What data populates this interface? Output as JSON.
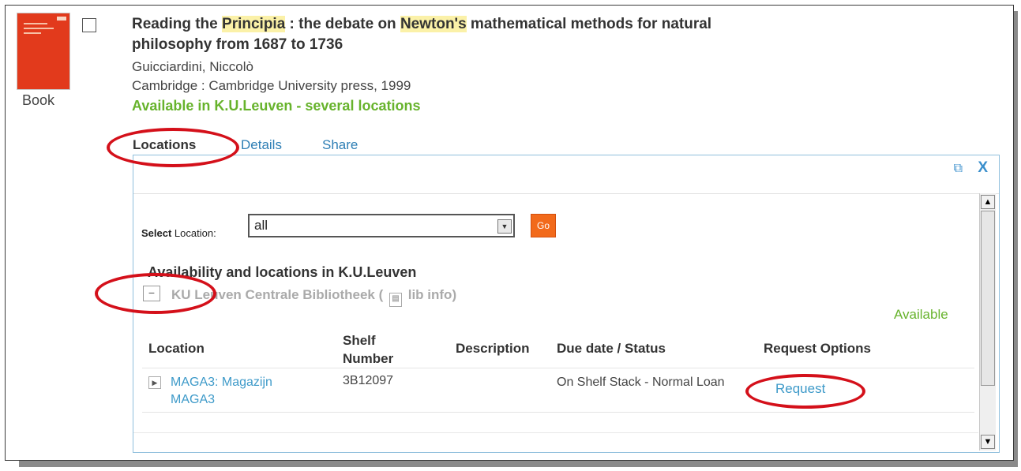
{
  "record": {
    "format": "Book",
    "title_part1": "Reading the ",
    "title_hl1": "Principia",
    "title_part2": " : the debate on ",
    "title_hl2": "Newton's",
    "title_part3": " mathematical methods for natural philosophy from 1687 to 1736",
    "author": "Guicciardini, Niccolò",
    "publisher": "Cambridge : Cambridge University press, 1999",
    "availability": "Available in K.U.Leuven - several locations"
  },
  "tabs": {
    "locations": "Locations",
    "details": "Details",
    "share": "Share"
  },
  "panel": {
    "close_label": "X",
    "select_location_bold": "Select",
    "select_location_label": " Location:",
    "select_value": "all",
    "go_label": "Go",
    "heading": "Availability and locations in K.U.Leuven",
    "library_name": "KU Leuven Centrale Bibliotheek",
    "lib_info": "lib info",
    "status_available": "Available",
    "columns": {
      "location": "Location",
      "shelf_number": "Shelf Number",
      "description": "Description",
      "due_status": "Due date / Status",
      "request_options": "Request Options"
    },
    "rows": [
      {
        "location": "MAGA3: Magazijn MAGA3",
        "shelf_number": "3B12097",
        "description": "",
        "due_status": "On Shelf Stack - Normal Loan",
        "request": "Request"
      }
    ]
  },
  "colors": {
    "available_green": "#67b32c",
    "link_blue": "#3e9ac9",
    "go_orange": "#f26a1b",
    "annotation_red": "#d4101a"
  }
}
